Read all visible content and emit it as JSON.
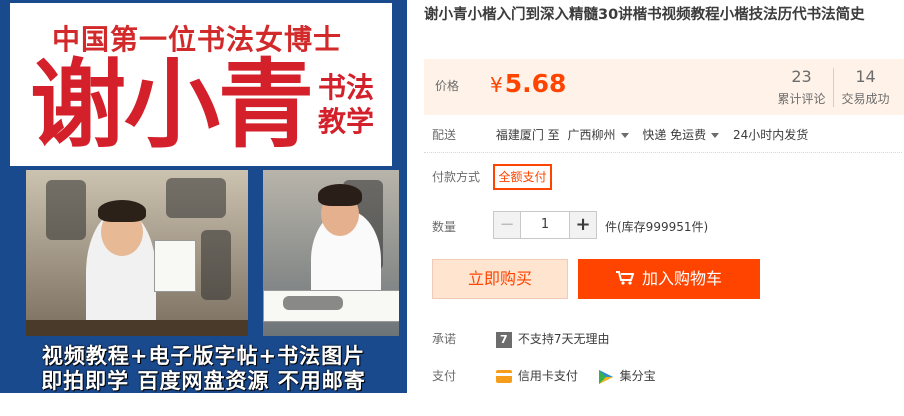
{
  "image": {
    "subtitle": "中国第一位书法女博士",
    "name": "谢小青",
    "tag_line1": "书法",
    "tag_line2": "教学",
    "banner_line1": "视频教程+电子版字帖+书法图片",
    "banner_line2": "即拍即学  百度网盘资源  不用邮寄"
  },
  "product": {
    "title": "谢小青小楷入门到深入精髓30讲楷书视频教程小楷技法历代书法简史"
  },
  "price": {
    "label": "价格",
    "currency": "¥",
    "value": "5.68",
    "reviews_count": "23",
    "reviews_label": "累计评论",
    "deals_count": "14",
    "deals_label": "交易成功"
  },
  "delivery": {
    "label": "配送",
    "from": "福建厦门 至",
    "to": "广西柳州",
    "shipping": "快递 免运费",
    "dispatch": "24小时内发货"
  },
  "payment_method": {
    "label": "付款方式",
    "option": "全额支付"
  },
  "quantity": {
    "label": "数量",
    "minus": "−",
    "value": "1",
    "plus": "+",
    "stock": "件(库存999951件)"
  },
  "actions": {
    "buy_now": "立即购买",
    "add_to_cart": "加入购物车"
  },
  "promise": {
    "label": "承诺",
    "icon_text": "7",
    "text": "不支持7天无理由"
  },
  "pay": {
    "label": "支付",
    "credit_card": "信用卡支付",
    "jifenbao": "集分宝"
  },
  "colors": {
    "accent": "#ff4400",
    "price_bg": "#fff2e8",
    "image_bg": "#1a4a8e",
    "image_red": "#d4202b"
  },
  "icons": [
    "cart-icon",
    "seven-day-icon",
    "credit-card-icon",
    "jifenbao-icon",
    "dropdown-caret-icon"
  ]
}
